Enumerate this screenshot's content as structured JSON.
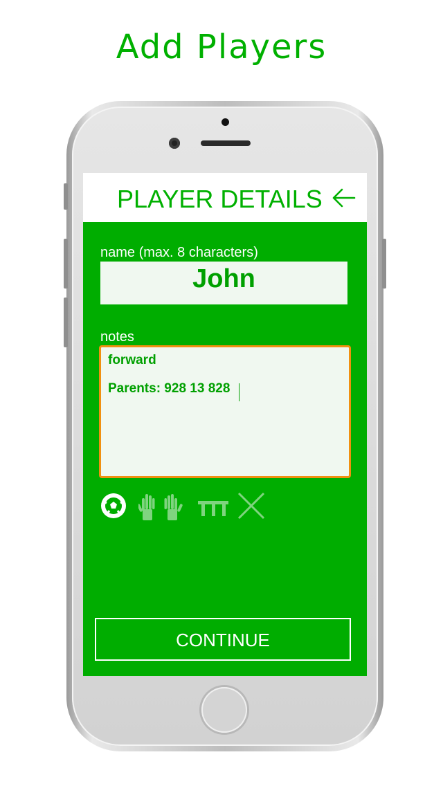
{
  "headline": "Add Players",
  "screen": {
    "title": "PLAYER DETAILS",
    "back_icon": "arrow-left-icon",
    "name_label": "name (max. 8 characters)",
    "name_value": "John",
    "notes_label": "notes",
    "notes_line1": "forward",
    "notes_line2": "Parents: 928 13 828",
    "position_icons": [
      "soccer-ball-icon",
      "goalkeeper-gloves-icon",
      "bench-icon",
      "close-icon"
    ],
    "continue_label": "CONTINUE"
  },
  "colors": {
    "accent_green": "#00ad00",
    "text_green": "#00a000",
    "focus_border": "#f09010",
    "field_background": "#f0f8f0"
  }
}
